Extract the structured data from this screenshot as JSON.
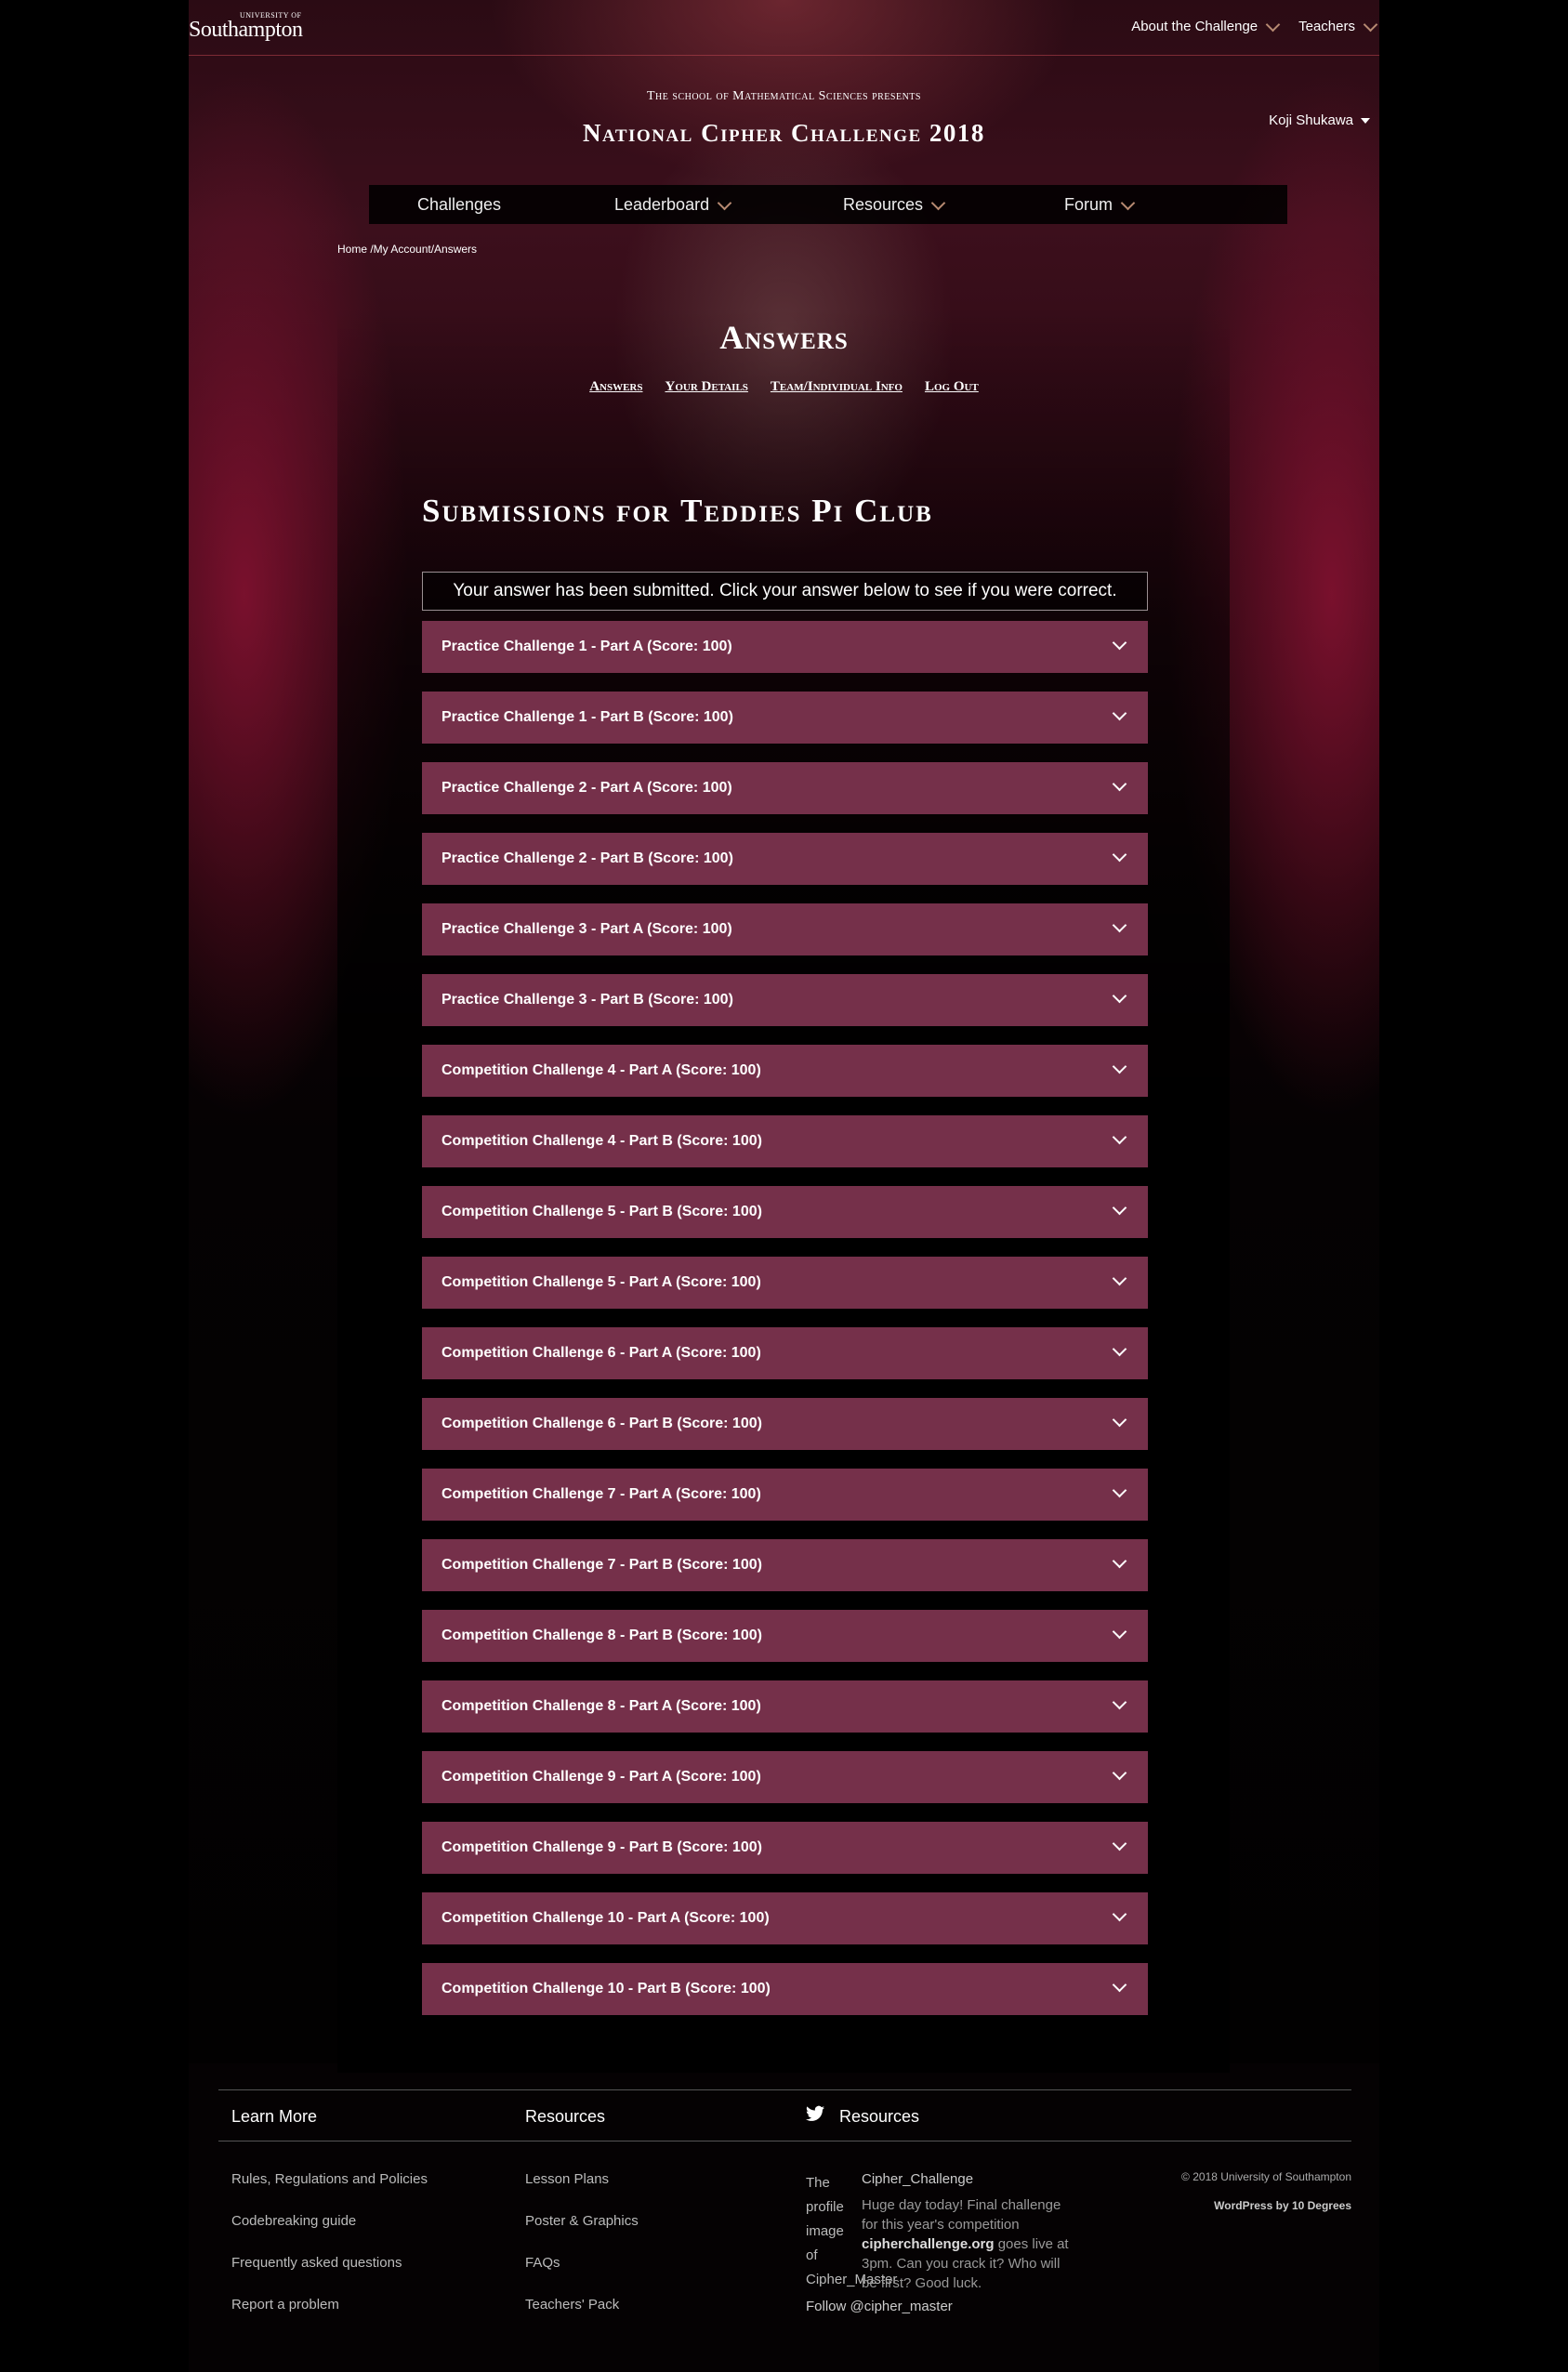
{
  "header": {
    "logo_small": "UNIVERSITY OF",
    "logo_big": "Southampton",
    "top_nav": [
      "About the Challenge",
      "Teachers"
    ],
    "presents": "The school of Mathematical Sciences presents",
    "title": "National Cipher Challenge 2018",
    "user": "Koji Shukawa"
  },
  "main_nav": [
    "Challenges",
    "Leaderboard",
    "Resources",
    "Forum"
  ],
  "breadcrumb": "Home /My Account/Answers",
  "page": {
    "heading": "Answers",
    "subnav": [
      "Answers",
      "Your Details",
      "Team/Individual Info",
      "Log Out"
    ],
    "subheading": "Submissions for Teddies Pi Club",
    "notice": "Your answer has been submitted. Click your answer below to see if you were correct."
  },
  "answers": [
    "Practice Challenge 1 - Part A (Score: 100)",
    "Practice Challenge 1 - Part B (Score: 100)",
    "Practice Challenge 2 - Part A (Score: 100)",
    "Practice Challenge 2 - Part B (Score: 100)",
    "Practice Challenge 3 - Part A (Score: 100)",
    "Practice Challenge 3 - Part B (Score: 100)",
    "Competition Challenge 4 - Part A (Score: 100)",
    "Competition Challenge 4 - Part B (Score: 100)",
    "Competition Challenge 5 - Part B (Score: 100)",
    "Competition Challenge 5 - Part A (Score: 100)",
    "Competition Challenge 6 - Part A (Score: 100)",
    "Competition Challenge 6 - Part B (Score: 100)",
    "Competition Challenge 7 - Part A (Score: 100)",
    "Competition Challenge 7 - Part B (Score: 100)",
    "Competition Challenge 8 - Part B (Score: 100)",
    "Competition Challenge 8 - Part A (Score: 100)",
    "Competition Challenge 9 - Part A (Score: 100)",
    "Competition Challenge 9 - Part B (Score: 100)",
    "Competition Challenge 10 - Part A (Score: 100)",
    "Competition Challenge 10 - Part B (Score: 100)"
  ],
  "footer": {
    "learn_more": {
      "heading": "Learn More",
      "links": [
        "Rules, Regulations and Policies",
        "Codebreaking guide",
        "Frequently asked questions",
        "Report a problem"
      ]
    },
    "resources": {
      "heading": "Resources",
      "links": [
        "Lesson Plans",
        "Poster & Graphics",
        "FAQs",
        "Teachers' Pack"
      ]
    },
    "twitter": {
      "heading": "Resources",
      "image_alt": "The profile image of Cipher_Master",
      "author": "Cipher_Challenge",
      "text_before": "Huge day today! Final challenge for this year's competition ",
      "text_link": "cipherchallenge.org",
      "text_after": " goes live at 3pm. Can you crack it? Who will be first? Good luck.",
      "follow": "Follow @cipher_master"
    },
    "copyright": "© 2018 University of Southampton",
    "credit": "WordPress by 10 Degrees"
  },
  "colors": {
    "answer_bg": "#75304a",
    "accent_chevron": "#b78a72",
    "page_bg": "#000000"
  }
}
